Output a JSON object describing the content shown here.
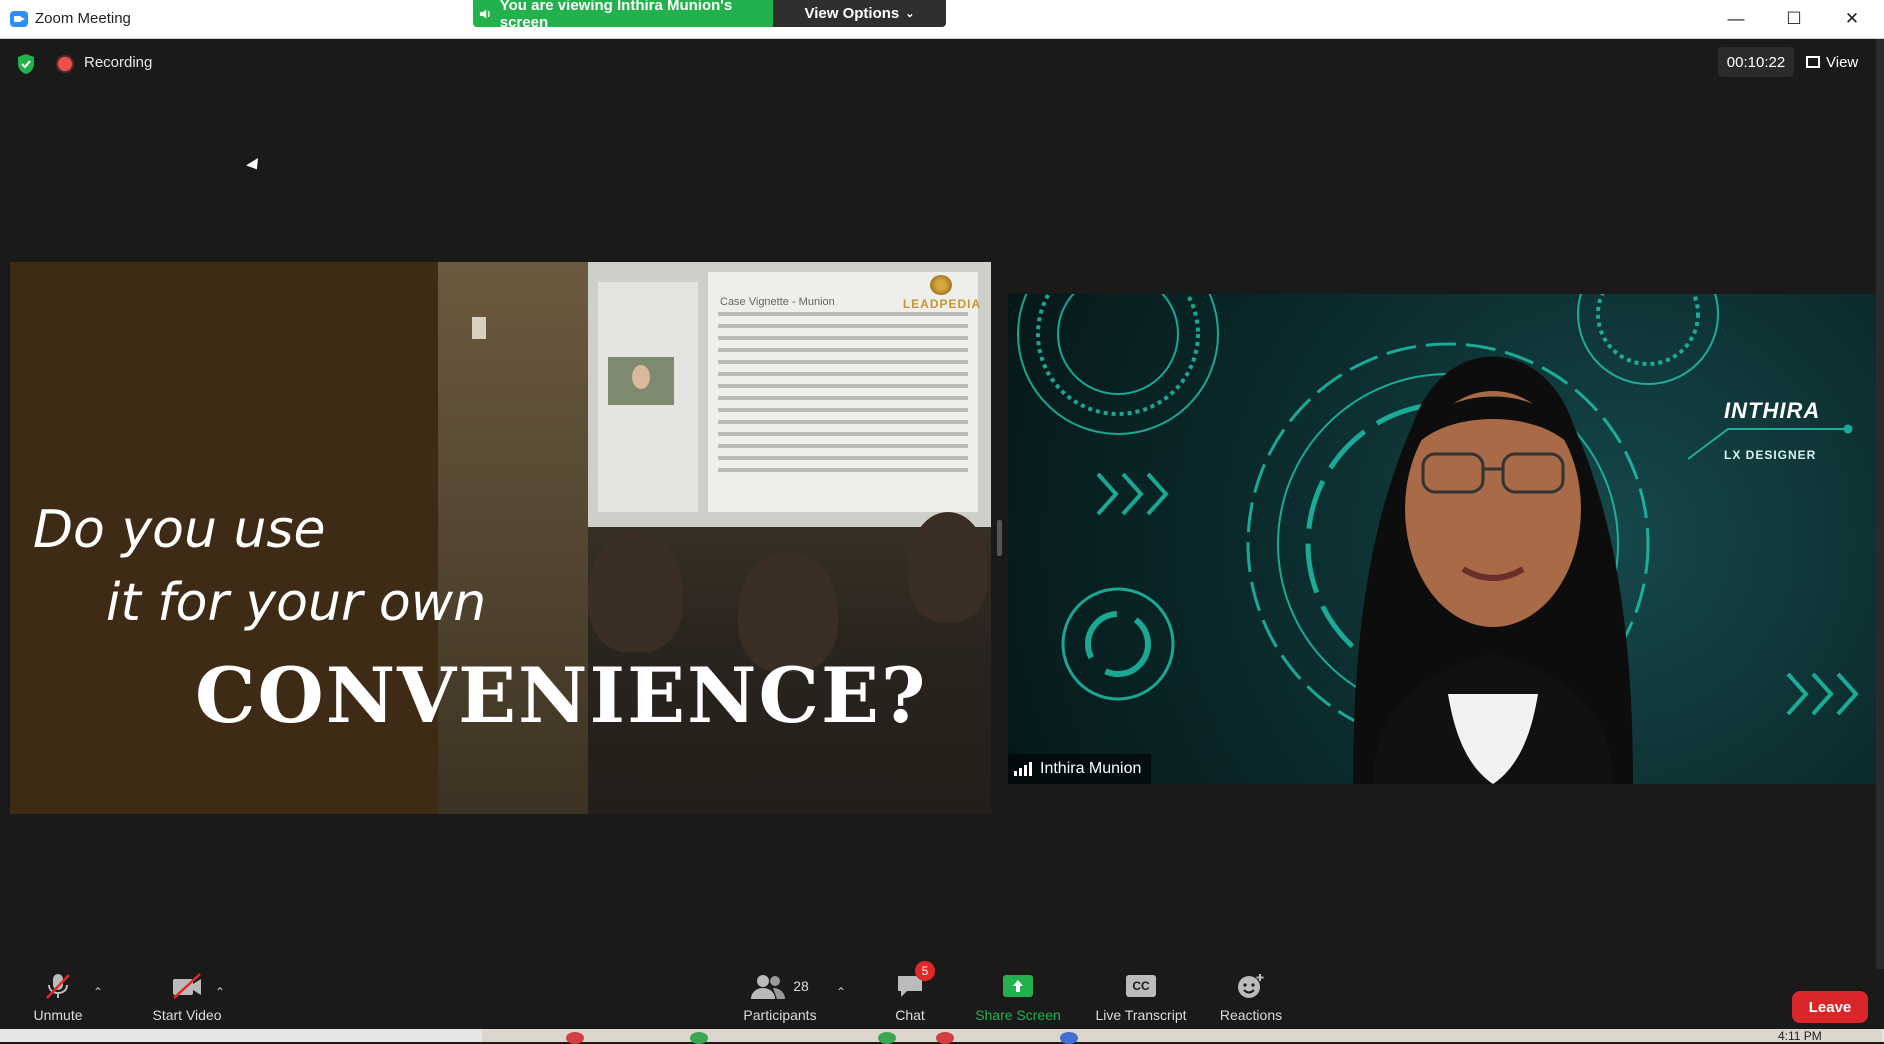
{
  "window": {
    "title": "Zoom Meeting",
    "controls": {
      "minimize": "—",
      "maximize": "☐",
      "close": "✕"
    }
  },
  "share_banner": {
    "viewing_text": "You are viewing Inthira Munion's screen",
    "options_label": "View Options",
    "colors": {
      "banner": "#23b14d",
      "options": "#2f2f2f"
    }
  },
  "status": {
    "recording_label": "Recording",
    "timer": "00:10:22",
    "view_label": "View"
  },
  "shared_slide": {
    "logo_text": "LEADPEDIA",
    "doc_title": "Case Vignette - Munion",
    "line1": "Do you use",
    "line2": "it for your own",
    "line3": "CONVENIENCE?"
  },
  "video_tile": {
    "participant_name": "Inthira Munion",
    "overlay_name": "INTHIRA",
    "overlay_role": "LX DESIGNER",
    "accent_color": "#1fc9b0"
  },
  "toolbar": {
    "unmute": "Unmute",
    "start_video": "Start Video",
    "participants_label": "Participants",
    "participants_count": "28",
    "chat_label": "Chat",
    "chat_badge": "5",
    "share_label": "Share Screen",
    "transcript_label": "Live Transcript",
    "transcript_icon": "CC",
    "reactions_label": "Reactions",
    "leave_label": "Leave",
    "share_color": "#23b14d",
    "leave_color": "#d9262b"
  },
  "taskbar": {
    "clock": "4:11 PM"
  }
}
